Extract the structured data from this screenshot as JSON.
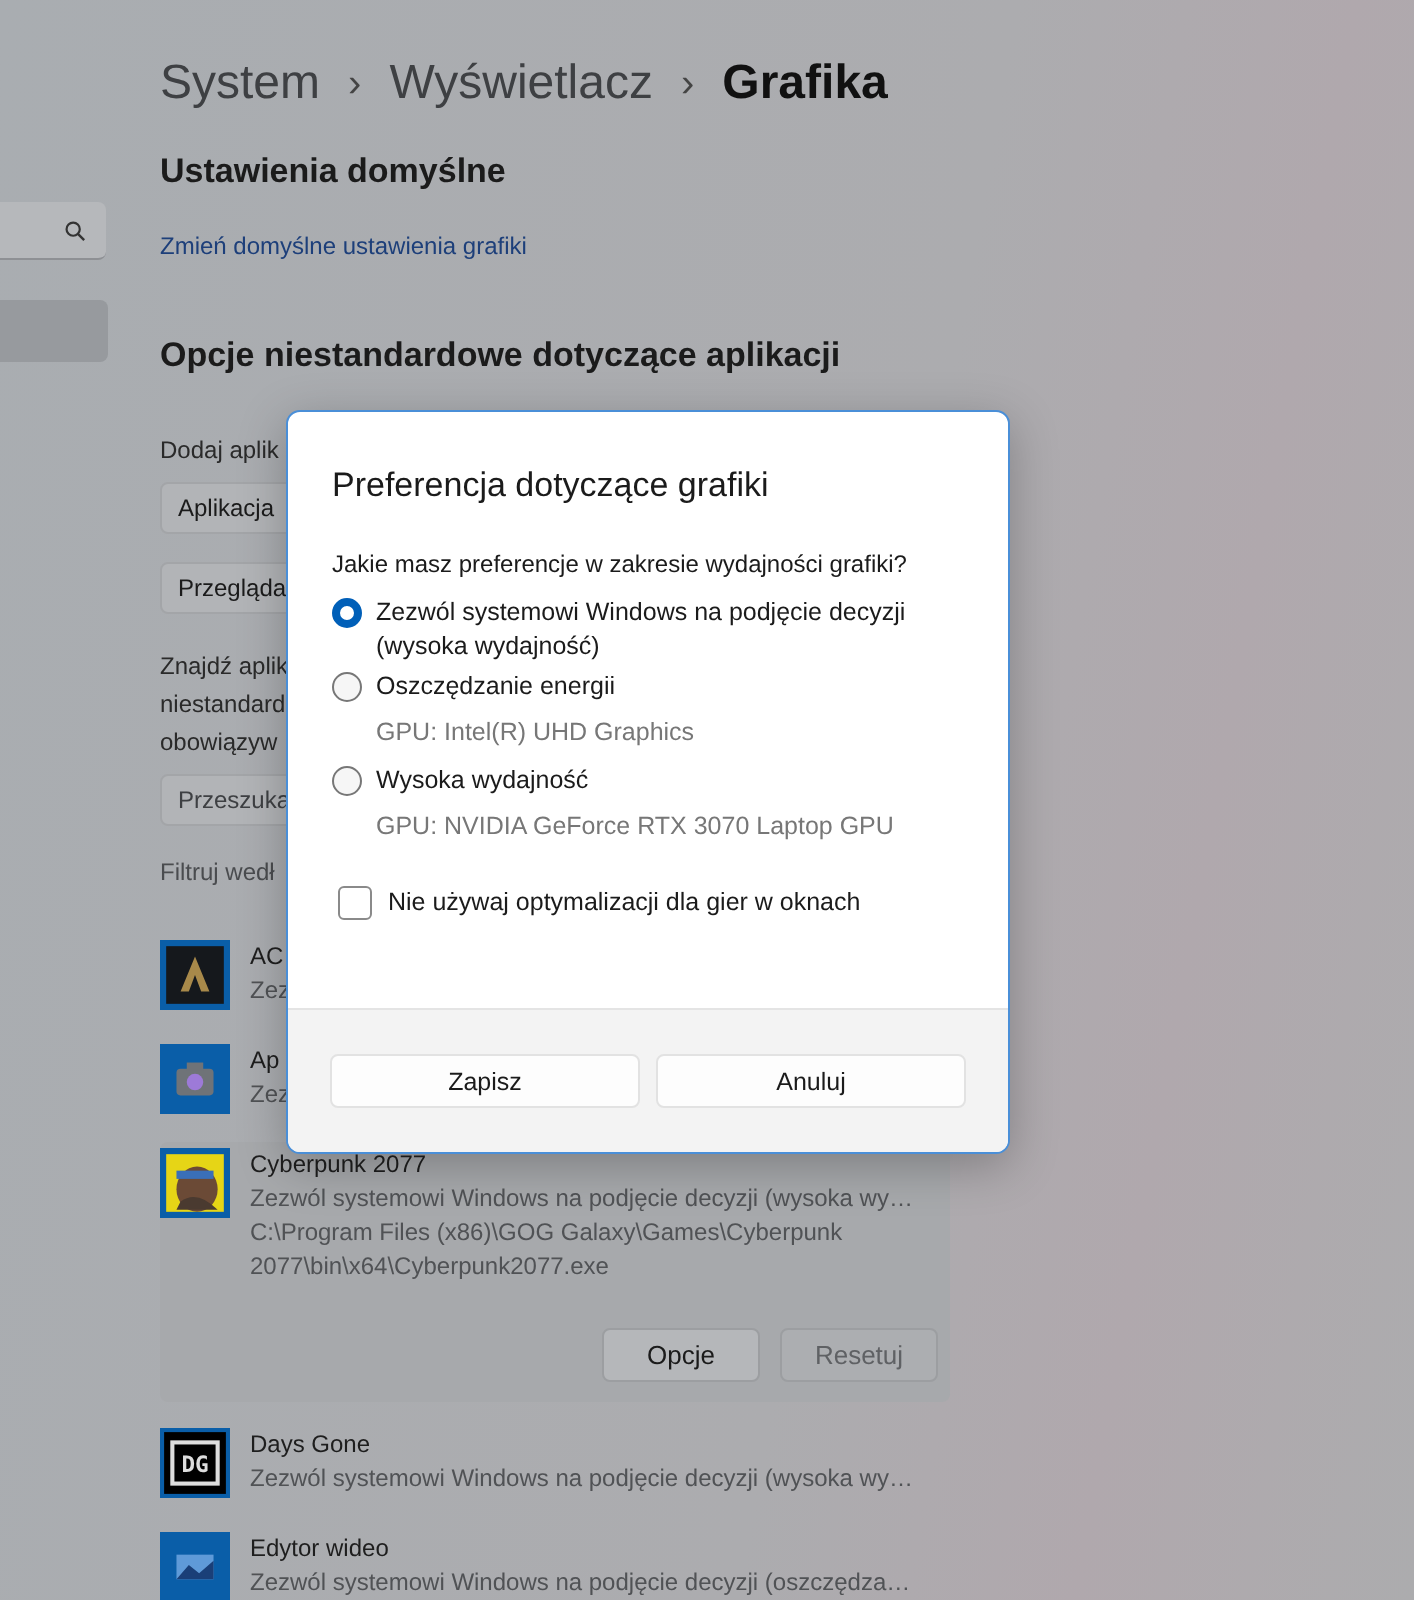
{
  "breadcrumb": [
    {
      "label": "System",
      "current": false
    },
    {
      "label": "Wyświetlacz",
      "current": false
    },
    {
      "label": "Grafika",
      "current": true
    }
  ],
  "breadcrumb_separator": "›",
  "default_section": {
    "title": "Ustawienia domyślne",
    "link": "Zmień domyślne ustawienia grafiki"
  },
  "custom_section": {
    "title": "Opcje niestandardowe dotyczące aplikacji",
    "add_label": "Dodaj aplik",
    "app_type_dropdown": "Aplikacja",
    "browse_button": "Przegląda",
    "find_text": [
      "Znajdź aplik",
      "niestandard",
      "obowiązyw"
    ],
    "search_placeholder": "Przeszuka",
    "filter_label": "Filtruj wedł"
  },
  "apps": [
    {
      "name": "AC",
      "status": "Zez",
      "expanded": false
    },
    {
      "name": "Ap",
      "status": "Zez",
      "expanded": false
    },
    {
      "name": "Cyberpunk 2077",
      "status": "Zezwól systemowi Windows na podjęcie decyzji (wysoka wy…",
      "expanded": true,
      "path": "C:\\Program Files (x86)\\GOG Galaxy\\Games\\Cyberpunk 2077\\bin\\x64\\Cyberpunk2077.exe",
      "buttons": [
        {
          "label": "Opcje",
          "disabled": false
        },
        {
          "label": "Resetuj",
          "disabled": true
        }
      ]
    },
    {
      "name": "Days Gone",
      "status": "Zezwól systemowi Windows na podjęcie decyzji (wysoka wy…",
      "expanded": false,
      "logo_text": "DG"
    },
    {
      "name": "Edytor wideo",
      "status": "Zezwól systemowi Windows na podjęcie decyzji (oszczędza…",
      "expanded": false
    }
  ],
  "dialog": {
    "title": "Preferencja dotyczące grafiki",
    "question": "Jakie masz preferencje w zakresie wydajności grafiki?",
    "options": [
      {
        "label": "Zezwól systemowi Windows na podjęcie decyzji (wysoka wydajność)",
        "selected": true
      },
      {
        "label": "Oszczędzanie energii",
        "detail": "GPU: Intel(R) UHD Graphics",
        "selected": false
      },
      {
        "label": "Wysoka wydajność",
        "detail": "GPU: NVIDIA GeForce RTX 3070 Laptop GPU",
        "selected": false
      }
    ],
    "checkbox": {
      "label": "Nie używaj optymalizacji dla gier w oknach",
      "checked": false
    },
    "buttons": [
      {
        "label": "Zapisz"
      },
      {
        "label": "Anuluj"
      }
    ]
  }
}
